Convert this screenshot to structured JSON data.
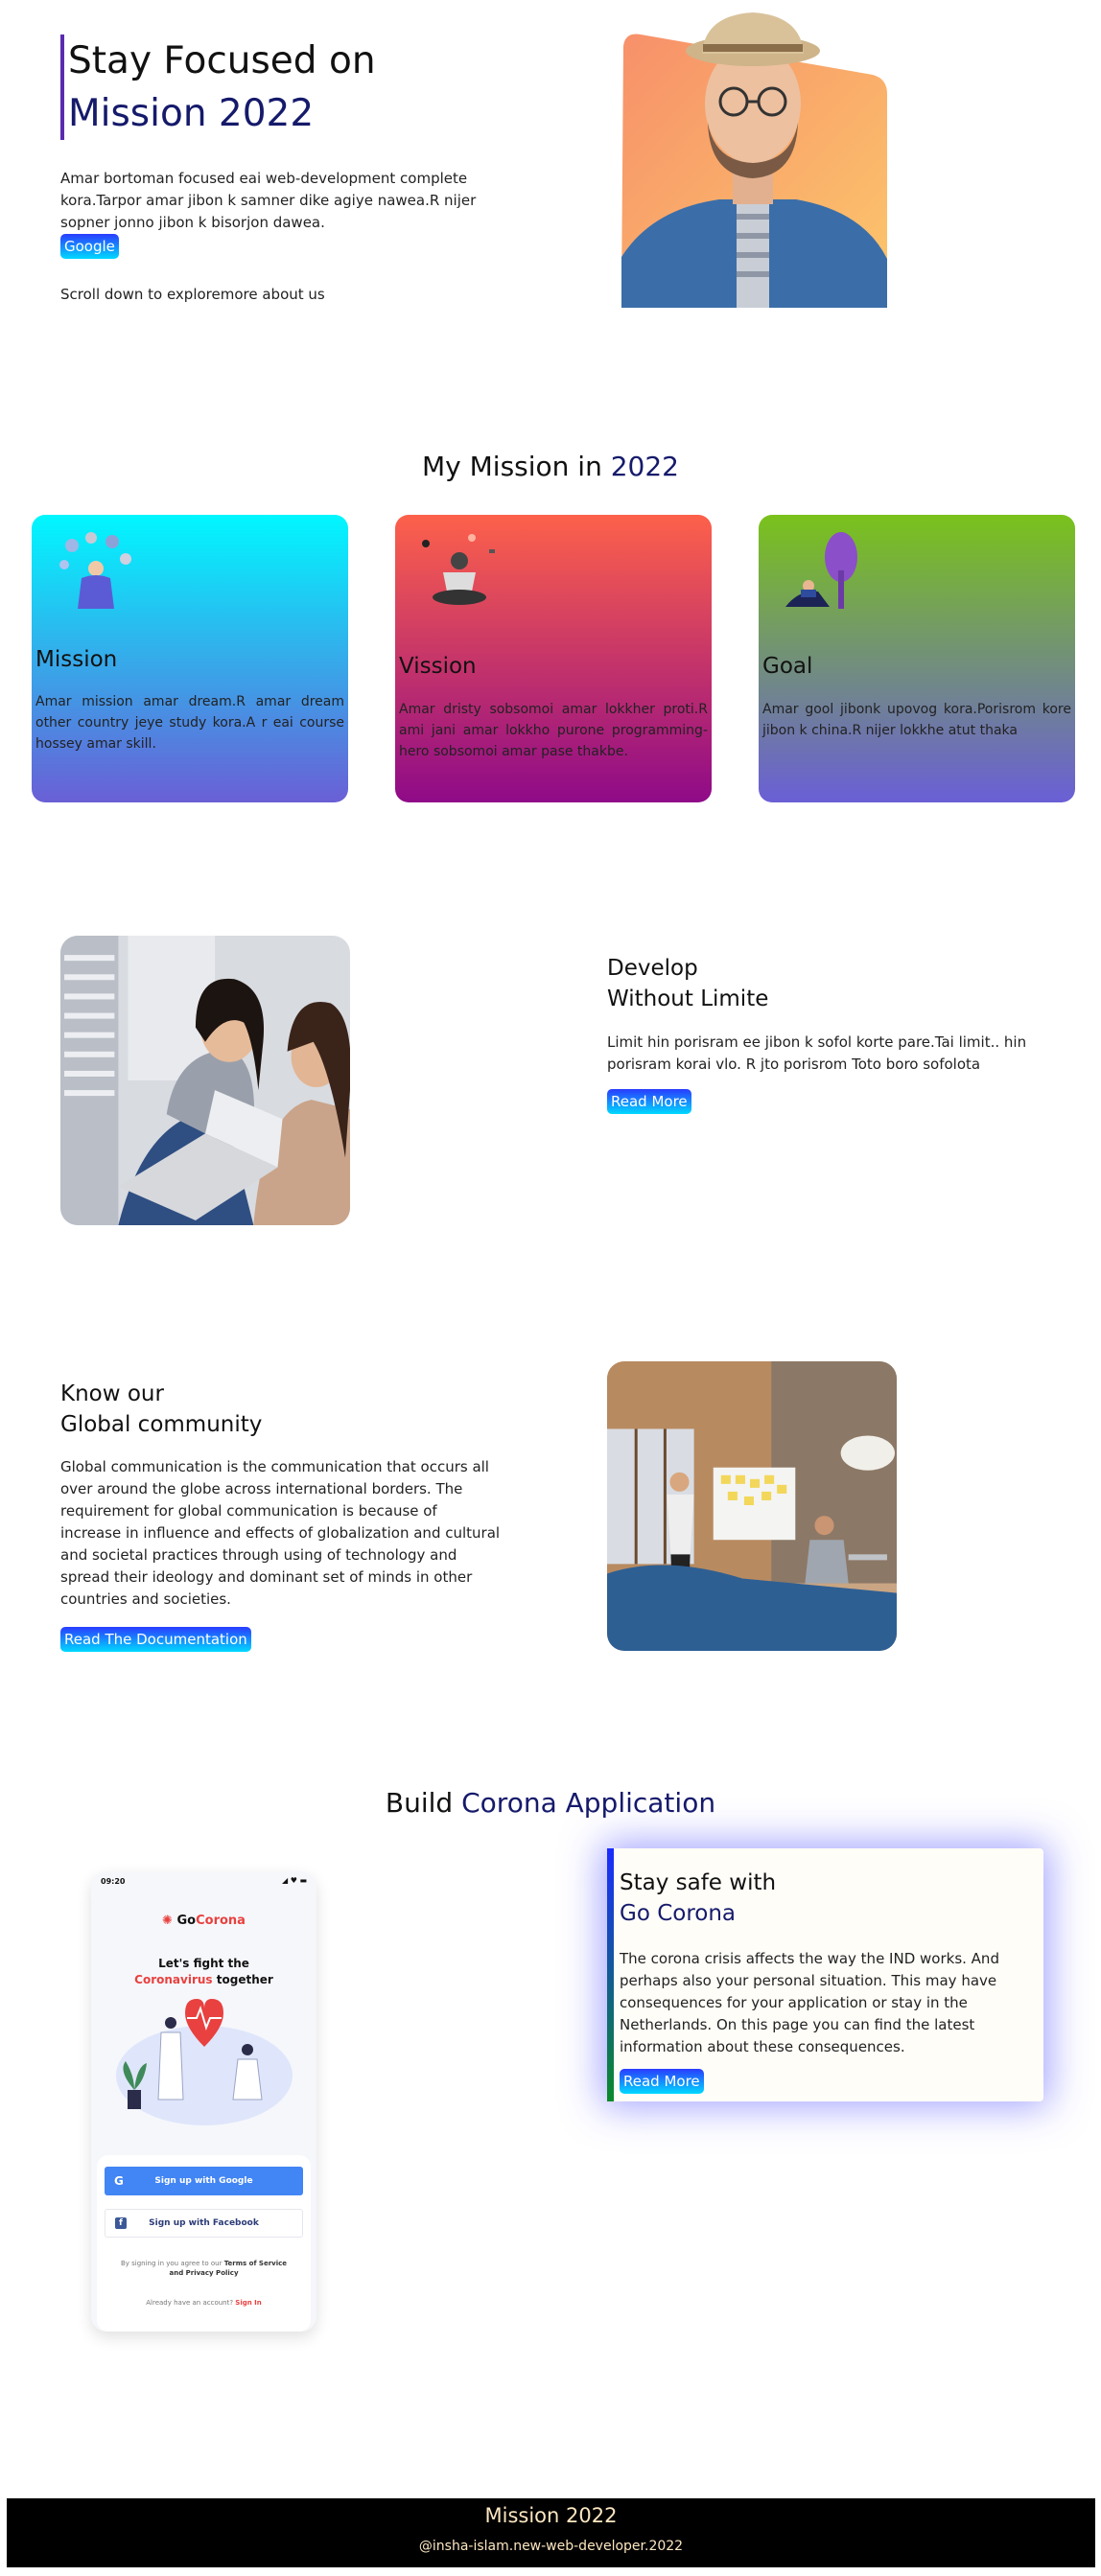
{
  "hero": {
    "title_line1": "Stay Focused on",
    "title_line2": "Mission 2022",
    "description": "Amar bortoman focused eai web-development complete kora.Tarpor amar jibon k samner dike agiye nawea.R nijer sopner jonno jibon k bisorjon dawea.",
    "button_label": "Google",
    "scroll_text": "Scroll down to exploremore about us"
  },
  "mission_section": {
    "heading_start": "My Mission in ",
    "heading_year": "2022",
    "cards": [
      {
        "title": "Mission",
        "text": "Amar mission amar dream.R amar dream other country jeye study kora.A r eai course hossey amar skill."
      },
      {
        "title": "Vission",
        "text": "Amar dristy sobsomoi amar lokkher proti.R ami jani amar lokkho purone programming-hero sobsomoi amar pase thakbe."
      },
      {
        "title": "Goal",
        "text": "Amar gool jibonk upovog kora.Porisrom kore jibon k china.R nijer lokkhe atut thaka"
      }
    ]
  },
  "develop": {
    "title_line1": "Develop",
    "title_line2": "Without Limite",
    "text": "Limit hin porisram ee jibon k sofol korte pare.Tai limit.. hin porisram korai vlo. R jto porisrom Toto boro sofolota",
    "button_label": "Read More"
  },
  "community": {
    "title_line1": "Know our",
    "title_line2": "Global community",
    "text": "Global communication is the communication that occurs all over around the globe across international borders. The requirement for global communication is because of increase in influence and effects of globalization and cultural and societal practices through using of technology and spread their ideology and dominant set of minds in other countries and societies.",
    "button_label": "Read The Documentation"
  },
  "corona": {
    "heading_start": "Build ",
    "heading_accent": "Corona Application",
    "phone": {
      "time": "09:20",
      "brand_go": "Go",
      "brand_corona": "Corona",
      "headline_line1": "Let's fight the",
      "headline_red": "Coronavirus",
      "headline_rest": " together",
      "google_button": "Sign up with Google",
      "facebook_button": "Sign up with Facebook",
      "terms_start": "By signing in you agree to our ",
      "terms_bold": "Terms of Service and Privacy Policy",
      "account_text": "Already have an account? ",
      "sign_in": "Sign In"
    },
    "card": {
      "title_line1": "Stay safe with",
      "title_line2": "Go Corona",
      "text": "The corona crisis affects the way the IND works. And perhaps also your personal situation. This may have consequences for your application or stay in the Netherlands. On this page you can find the latest information about these consequences.",
      "button_label": "Read More"
    }
  },
  "footer": {
    "title": "Mission 2022",
    "credit": "@insha-islam.new-web-developer.2022"
  }
}
